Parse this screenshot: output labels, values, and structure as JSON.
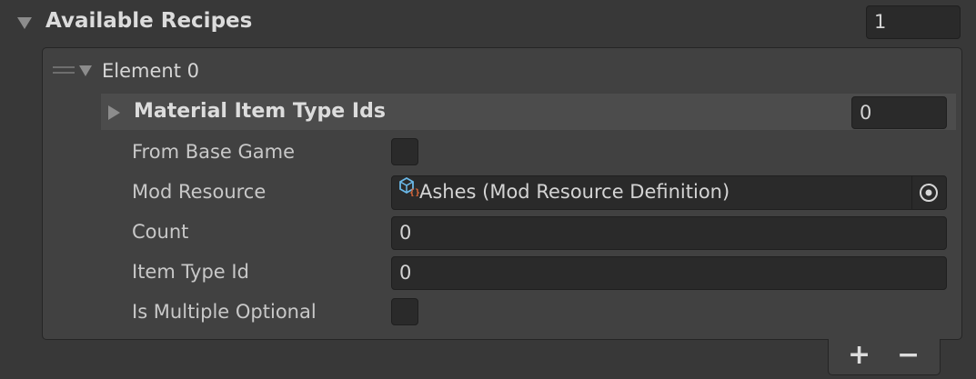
{
  "available_recipes": {
    "label": "Available Recipes",
    "size": "1"
  },
  "element": {
    "label": "Element 0",
    "material_item_type_ids": {
      "label": "Material Item Type Ids",
      "size": "0"
    },
    "from_base_game": {
      "label": "From Base Game",
      "checked": false
    },
    "mod_resource": {
      "label": "Mod Resource",
      "value": "Ashes (Mod Resource Definition)",
      "icon": "mod-resource-asset-icon"
    },
    "count": {
      "label": "Count",
      "value": "0"
    },
    "item_type_id": {
      "label": "Item Type Id",
      "value": "0"
    },
    "is_multiple_optional": {
      "label": "Is Multiple Optional",
      "checked": false
    }
  },
  "footer": {
    "add_label": "+",
    "remove_label": "−"
  },
  "colors": {
    "background": "#383838",
    "panel": "#414141",
    "field": "#2a2a2a",
    "text": "#d2d2d2"
  }
}
